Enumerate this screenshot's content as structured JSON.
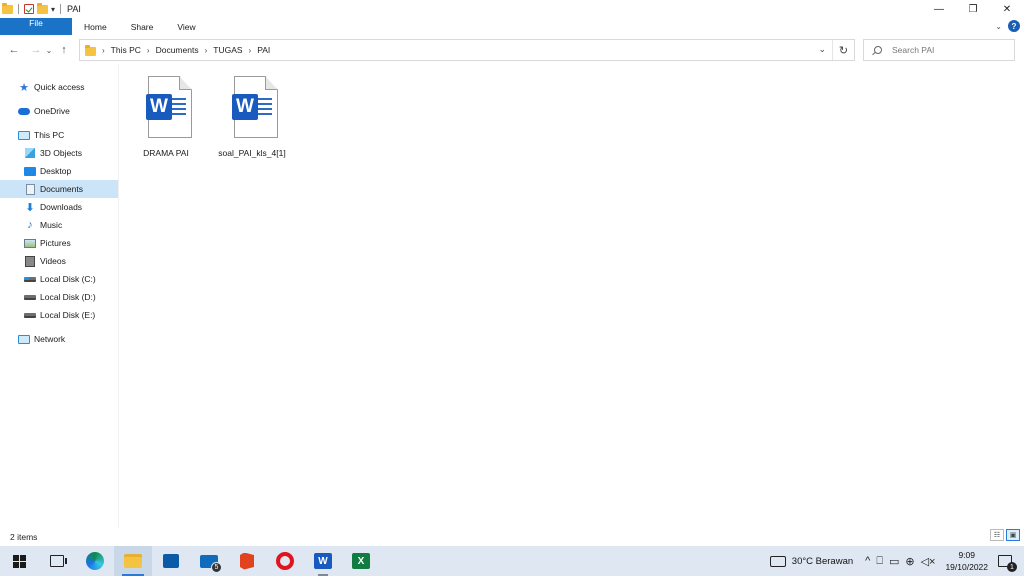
{
  "window": {
    "title": "PAI",
    "controls": {
      "minimize": "—",
      "restore": "❐",
      "close": "✕"
    }
  },
  "ribbon": {
    "tabs": [
      "File",
      "Home",
      "Share",
      "View"
    ]
  },
  "address": {
    "crumbs": [
      "This PC",
      "Documents",
      "TUGAS",
      "PAI"
    ]
  },
  "search": {
    "placeholder": "Search PAI"
  },
  "nav": {
    "quick_access": "Quick access",
    "onedrive": "OneDrive",
    "this_pc": "This PC",
    "children": [
      "3D Objects",
      "Desktop",
      "Documents",
      "Downloads",
      "Music",
      "Pictures",
      "Videos",
      "Local Disk (C:)",
      "Local Disk (D:)",
      "Local Disk (E:)"
    ],
    "network": "Network",
    "selected": "Documents"
  },
  "files": [
    {
      "name": "DRAMA PAI",
      "type": "word-document"
    },
    {
      "name": "soal_PAI_kls_4[1]",
      "type": "word-document"
    }
  ],
  "status": {
    "count": "2 items"
  },
  "taskbar": {
    "mail_badge": "5",
    "weather": "30°C  Berawan",
    "time": "9:09",
    "date": "19/10/2022",
    "notifications": "1"
  },
  "colors": {
    "accent": "#1a73c6",
    "selection": "#cce4f7",
    "word": "#185abd",
    "excel": "#107c41"
  }
}
